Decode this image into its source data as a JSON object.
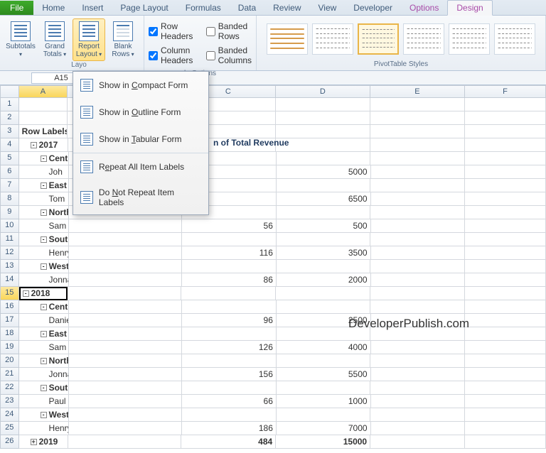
{
  "tabs": {
    "file": "File",
    "home": "Home",
    "insert": "Insert",
    "pagelayout": "Page Layout",
    "formulas": "Formulas",
    "data": "Data",
    "review": "Review",
    "view": "View",
    "developer": "Developer",
    "options": "Options",
    "design": "Design"
  },
  "ribbon": {
    "subtotals": "Subtotals",
    "grand": "Grand\nTotals",
    "report": "Report\nLayout",
    "blank": "Blank\nRows",
    "rowhdr": "Row Headers",
    "colhdr": "Column Headers",
    "brows": "Banded Rows",
    "bcols": "Banded Columns",
    "g_layout": "Layout",
    "g_opts": "le Options",
    "g_styles": "PivotTable Styles"
  },
  "namebox": "A15",
  "cols": [
    "A",
    "C",
    "D",
    "E",
    "F"
  ],
  "menu": {
    "compact": "Show in Compact Form",
    "outline": "Show in Outline Form",
    "tabular": "Show in Tabular Form",
    "repeat": "Repeat All Item Labels",
    "norepeat": "Do Not Repeat Item Labels"
  },
  "colheader_c": "n of Total Revenue",
  "grid": [
    {
      "r": 1,
      "a": ""
    },
    {
      "r": 2,
      "a": ""
    },
    {
      "r": 3,
      "a": "Row Labels",
      "hdr": true
    },
    {
      "r": 4,
      "a": "2017",
      "exp": "-",
      "bold": true,
      "i": 1
    },
    {
      "r": 5,
      "a": "Centra",
      "exp": "-",
      "bold": true,
      "i": 2
    },
    {
      "r": 6,
      "a": "Joh",
      "i": 3,
      "d": "5000"
    },
    {
      "r": 7,
      "a": "East",
      "exp": "-",
      "bold": true,
      "i": 2
    },
    {
      "r": 8,
      "a": "Tom",
      "i": 3,
      "d": "6500"
    },
    {
      "r": 9,
      "a": "North",
      "exp": "-",
      "bold": true,
      "i": 2
    },
    {
      "r": 10,
      "a": "Sam",
      "i": 3,
      "c": "56",
      "d": "500"
    },
    {
      "r": 11,
      "a": "South",
      "exp": "-",
      "bold": true,
      "i": 2
    },
    {
      "r": 12,
      "a": "Henry",
      "i": 3,
      "c": "116",
      "d": "3500"
    },
    {
      "r": 13,
      "a": "West",
      "exp": "-",
      "bold": true,
      "i": 2
    },
    {
      "r": 14,
      "a": "Jonnas",
      "i": 3,
      "c": "86",
      "d": "2000"
    },
    {
      "r": 15,
      "a": "2018",
      "exp": "-",
      "bold": true,
      "i": 1,
      "sel": true
    },
    {
      "r": 16,
      "a": "Central",
      "exp": "-",
      "bold": true,
      "i": 2
    },
    {
      "r": 17,
      "a": "Daniel",
      "i": 3,
      "c": "96",
      "d": "2500"
    },
    {
      "r": 18,
      "a": "East",
      "exp": "-",
      "bold": true,
      "i": 2
    },
    {
      "r": 19,
      "a": "Sam",
      "i": 3,
      "c": "126",
      "d": "4000"
    },
    {
      "r": 20,
      "a": "North",
      "exp": "-",
      "bold": true,
      "i": 2
    },
    {
      "r": 21,
      "a": "Jonnas",
      "i": 3,
      "c": "156",
      "d": "5500"
    },
    {
      "r": 22,
      "a": "South",
      "exp": "-",
      "bold": true,
      "i": 2
    },
    {
      "r": 23,
      "a": "Paul",
      "i": 3,
      "c": "66",
      "d": "1000"
    },
    {
      "r": 24,
      "a": "West",
      "exp": "-",
      "bold": true,
      "i": 2
    },
    {
      "r": 25,
      "a": "Henry",
      "i": 3,
      "c": "186",
      "d": "7000"
    },
    {
      "r": 26,
      "a": "2019",
      "exp": "+",
      "bold": true,
      "i": 1,
      "c": "484",
      "d": "15000",
      "boldrow": true
    }
  ],
  "watermark": "DeveloperPublish.com"
}
